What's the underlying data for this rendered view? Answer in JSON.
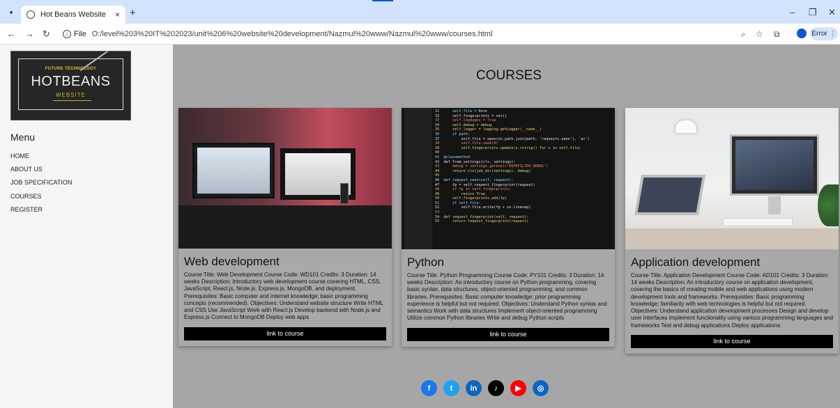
{
  "browser": {
    "tab_title": "Hot Beans Website",
    "tab_close": "×",
    "new_tab": "+",
    "file_label": "File",
    "url": "O:/level%203%20IT%202023/unit%206%20website%20development/Nazmul%20www/Nazmul%20www/courses.html",
    "profile_status": "Error",
    "icons": [
      "tab-list-icon",
      "back-icon",
      "forward-icon",
      "reload-icon",
      "info-icon",
      "zoom-icon",
      "bookmark-star-icon",
      "extensions-icon",
      "profile-icon",
      "kebab-menu-icon",
      "minimize-icon",
      "restore-icon",
      "close-icon"
    ]
  },
  "sidebar": {
    "logo": {
      "tagline": "FUTURE TECHNOLOGY",
      "brand": "HOTBEANS",
      "sub": "WEBSITE"
    },
    "menu_title": "Menu",
    "items": [
      "HOME",
      "ABOUT US",
      "JOB SPECIFICATION",
      "COURSES",
      "REGISTER"
    ]
  },
  "main": {
    "heading": "COURSES",
    "courses": [
      {
        "title": "Web development",
        "description": "Course Title: Web Development Course Code: WD101 Credits: 3 Duration: 14 weeks Description: Introductory web development course covering HTML, CSS, JavaScript, React.js, Node.js, Express.js, MongoDB, and deployment. Prerequisites: Basic computer and internet knowledge; basic programming concepts (recommended). Objectives: Understand website structure Write HTML and CSS Use JavaScript Work with React.js Develop backend with Node.js and Express.js Connect to MongoDB Deploy web apps",
        "link_label": "link to course"
      },
      {
        "title": "Python",
        "description": "Course Title: Python Programming Course Code: PY101 Credits: 3 Duration: 14 weeks Description: An introductory course on Python programming, covering basic syntax, data structures, object-oriented programming, and common libraries. Prerequisites: Basic computer knowledge; prior programming experience is helpful but not required. Objectives: Understand Python syntax and semantics Work with data structures Implement object-oriented programming Utilize common Python libraries Write and debug Python scripts",
        "link_label": "link to course"
      },
      {
        "title": "Application development",
        "description": "Course Title: Application Development Course Code: AD101 Credits: 3 Duration: 14 weeks Description: An introductory course on application development, covering the basics of creating mobile and web applications using modern development tools and frameworks. Prerequisites: Basic programming knowledge; familiarity with web technologies is helpful but not required. Objectives: Understand application development processes Design and develop user interfaces Implement functionality using various programming languages and frameworks Test and debug applications Deploy applications",
        "link_label": "link to course"
      }
    ],
    "code_lines": [
      "31      self.file = None",
      "32      self.fingerprints = set()",
      "33      self.logdupes = True",
      "34      self.debug = debug",
      "35      self.logger = logging.getLogger(__name__)",
      "36      if path:",
      "37          self.file = open(os.path.join(path, 'requests.seen'), 'a+')",
      "38          self.file.seek(0)",
      "39          self.fingerprints.update(x.rstrip() for x in self.file)",
      "40",
      "41  @classmethod",
      "42  def from_settings(cls, settings):",
      "43      debug = settings.getbool('DUPEFILTER_DEBUG')",
      "44      return cls(job_dir(settings), debug)",
      "45",
      "46  def request_seen(self, request):",
      "47      fp = self.request_fingerprint(request)",
      "48      if fp in self.fingerprints:",
      "49          return True",
      "50      self.fingerprints.add(fp)",
      "51      if self.file:",
      "52          self.file.write(fp + os.linesep)",
      "53",
      "54  def request_fingerprint(self, request):",
      "55      return request_fingerprint(request)"
    ],
    "social": [
      {
        "name": "facebook-icon",
        "glyph": "f",
        "color": "#1877f2"
      },
      {
        "name": "twitter-icon",
        "glyph": "t",
        "color": "#1da1f2"
      },
      {
        "name": "linkedin-icon",
        "glyph": "in",
        "color": "#0a66c2"
      },
      {
        "name": "tiktok-icon",
        "glyph": "♪",
        "color": "#000000"
      },
      {
        "name": "youtube-icon",
        "glyph": "▶",
        "color": "#ff0000"
      },
      {
        "name": "instagram-icon",
        "glyph": "◎",
        "color": "#0a66c2"
      }
    ]
  }
}
